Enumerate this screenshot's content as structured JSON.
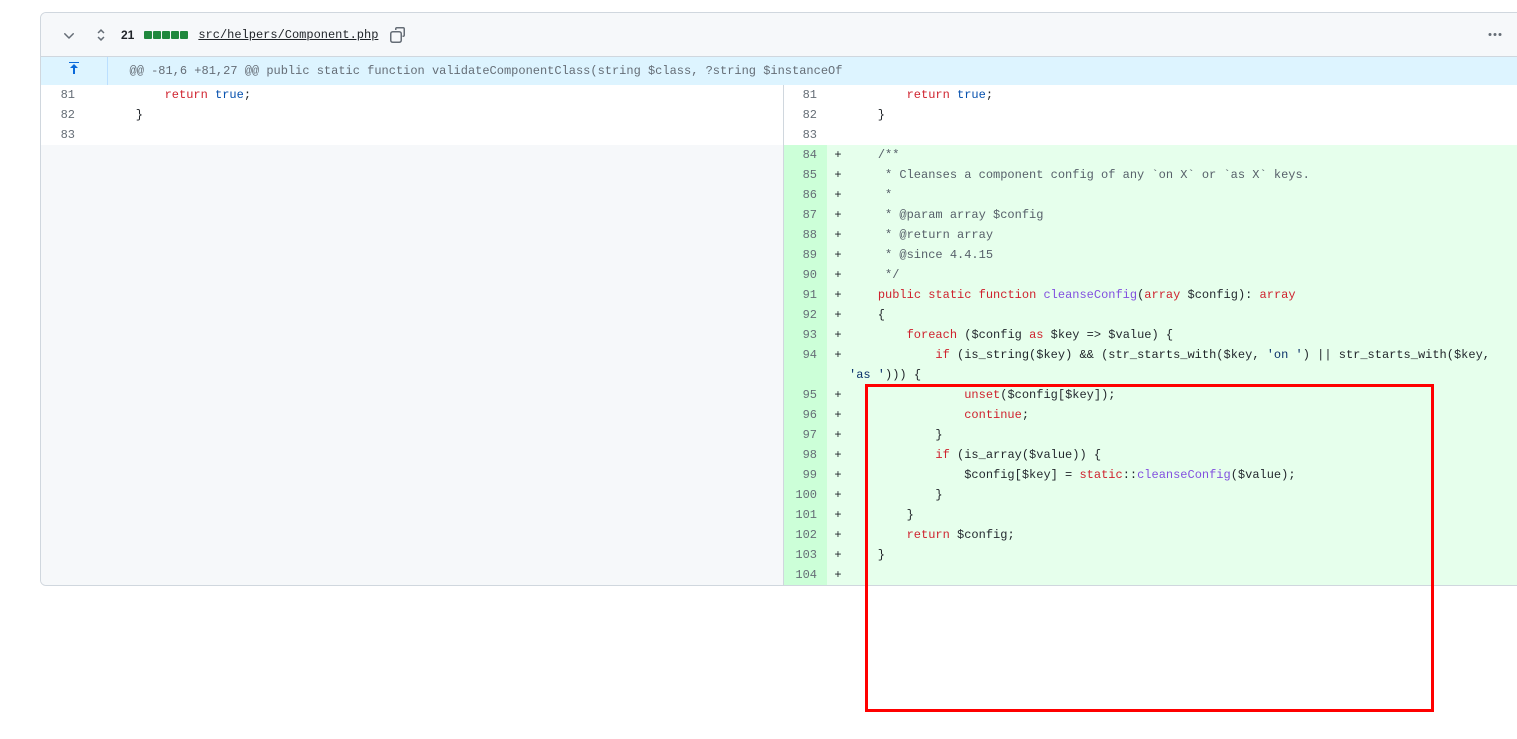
{
  "header": {
    "additions": "21",
    "file_path": "src/helpers/Component.php"
  },
  "hunk": "@@ -81,6 +81,27 @@ public static function validateComponentClass(string $class, ?string $instanceOf",
  "rows": [
    {
      "type": "ctx",
      "ln_l": "81",
      "ln_r": "81",
      "html_l": "        <span class='kw'>return</span> <span class='const'>true</span>;",
      "html_r": "        <span class='kw'>return</span> <span class='const'>true</span>;"
    },
    {
      "type": "ctx",
      "ln_l": "82",
      "ln_r": "82",
      "html_l": "    }",
      "html_r": "    }"
    },
    {
      "type": "ctx",
      "ln_l": "83",
      "ln_r": "83",
      "html_l": "",
      "html_r": ""
    },
    {
      "type": "add",
      "ln_r": "84",
      "html_r": "    <span class='cm'>/**</span>"
    },
    {
      "type": "add",
      "ln_r": "85",
      "html_r": "<span class='cm'>     * Cleanses a component config of any `on X` or `as X` keys.</span>"
    },
    {
      "type": "add",
      "ln_r": "86",
      "html_r": "<span class='cm'>     *</span>"
    },
    {
      "type": "add",
      "ln_r": "87",
      "html_r": "<span class='cm'>     * @param array $config</span>"
    },
    {
      "type": "add",
      "ln_r": "88",
      "html_r": "<span class='cm'>     * @return array</span>"
    },
    {
      "type": "add",
      "ln_r": "89",
      "html_r": "<span class='cm'>     * @since 4.4.15</span>"
    },
    {
      "type": "add",
      "ln_r": "90",
      "html_r": "<span class='cm'>     */</span>"
    },
    {
      "type": "add",
      "ln_r": "91",
      "html_r": "    <span class='kw'>public</span> <span class='kw'>static</span> <span class='kw'>function</span> <span class='fn'>cleanseConfig</span>(<span class='kw'>array</span> <span class='var'>$config</span>): <span class='kw'>array</span>"
    },
    {
      "type": "add",
      "ln_r": "92",
      "html_r": "    {"
    },
    {
      "type": "add",
      "ln_r": "93",
      "html_r": "        <span class='kw'>foreach</span> (<span class='var'>$config</span> <span class='kw'>as</span> <span class='var'>$key</span> =&gt; <span class='var'>$value</span>) {"
    },
    {
      "type": "add",
      "ln_r": "94",
      "html_r": "            <span class='kw'>if</span> (is_string(<span class='var'>$key</span>) &amp;&amp; (str_starts_with(<span class='var'>$key</span>, <span class='lit'>'on '</span>) || str_starts_with(<span class='var'>$key</span>, <span class='lit'>'as '</span>))) {",
      "wrap": true
    },
    {
      "type": "add",
      "ln_r": "95",
      "html_r": "                <span class='kw'>unset</span>(<span class='var'>$config</span>[<span class='var'>$key</span>]);"
    },
    {
      "type": "add",
      "ln_r": "96",
      "html_r": "                <span class='kw'>continue</span>;"
    },
    {
      "type": "add",
      "ln_r": "97",
      "html_r": "            }"
    },
    {
      "type": "add",
      "ln_r": "98",
      "html_r": "            <span class='kw'>if</span> (is_array(<span class='var'>$value</span>)) {"
    },
    {
      "type": "add",
      "ln_r": "99",
      "html_r": "                <span class='var'>$config</span>[<span class='var'>$key</span>] = <span class='kw'>static</span>::<span class='fn'>cleanseConfig</span>(<span class='var'>$value</span>);"
    },
    {
      "type": "add",
      "ln_r": "100",
      "html_r": "            }"
    },
    {
      "type": "add",
      "ln_r": "101",
      "html_r": "        }"
    },
    {
      "type": "add",
      "ln_r": "102",
      "html_r": "        <span class='kw'>return</span> <span class='var'>$config</span>;"
    },
    {
      "type": "add",
      "ln_r": "103",
      "html_r": "    }"
    },
    {
      "type": "add",
      "ln_r": "104",
      "html_r": ""
    }
  ]
}
